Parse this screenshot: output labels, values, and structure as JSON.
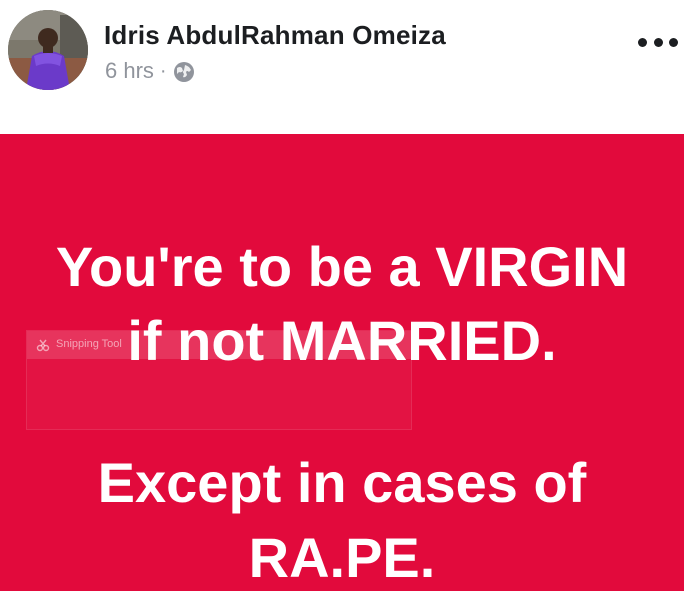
{
  "post": {
    "author_name": "Idris AbdulRahman Omeiza",
    "time": "6 hrs",
    "separator": "·",
    "privacy_icon": "globe-icon",
    "menu_icon": "more-options-icon"
  },
  "card": {
    "background": "#e20a3c",
    "text_color": "#ffffff",
    "lines": [
      "You're to be a VIRGIN",
      "if not MARRIED.",
      "Except in cases of",
      "RA.PE."
    ]
  },
  "overlay": {
    "label": "Snipping Tool"
  }
}
